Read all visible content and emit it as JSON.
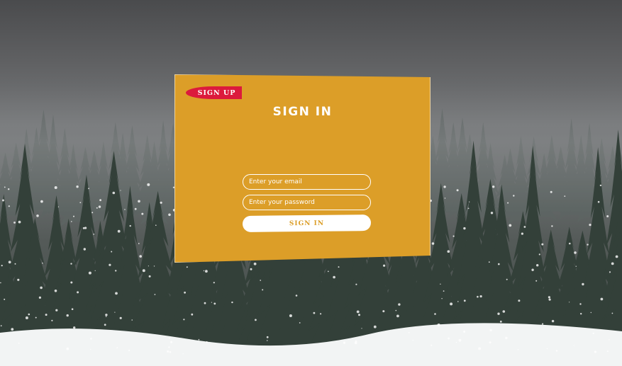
{
  "background": {
    "icon": "snowy-pine-forest-photo",
    "sky_color": "#6e7072",
    "tree_color": "#2f3a37",
    "snow_color": "#ffffff"
  },
  "card": {
    "color": "#dc9e28",
    "signup_tab_label": "SIGN UP",
    "signup_tab_color": "#dc1a3c",
    "title": "SIGN IN",
    "email_placeholder": "Enter your email",
    "password_placeholder": "Enter your password",
    "submit_label": "SIGN IN"
  }
}
